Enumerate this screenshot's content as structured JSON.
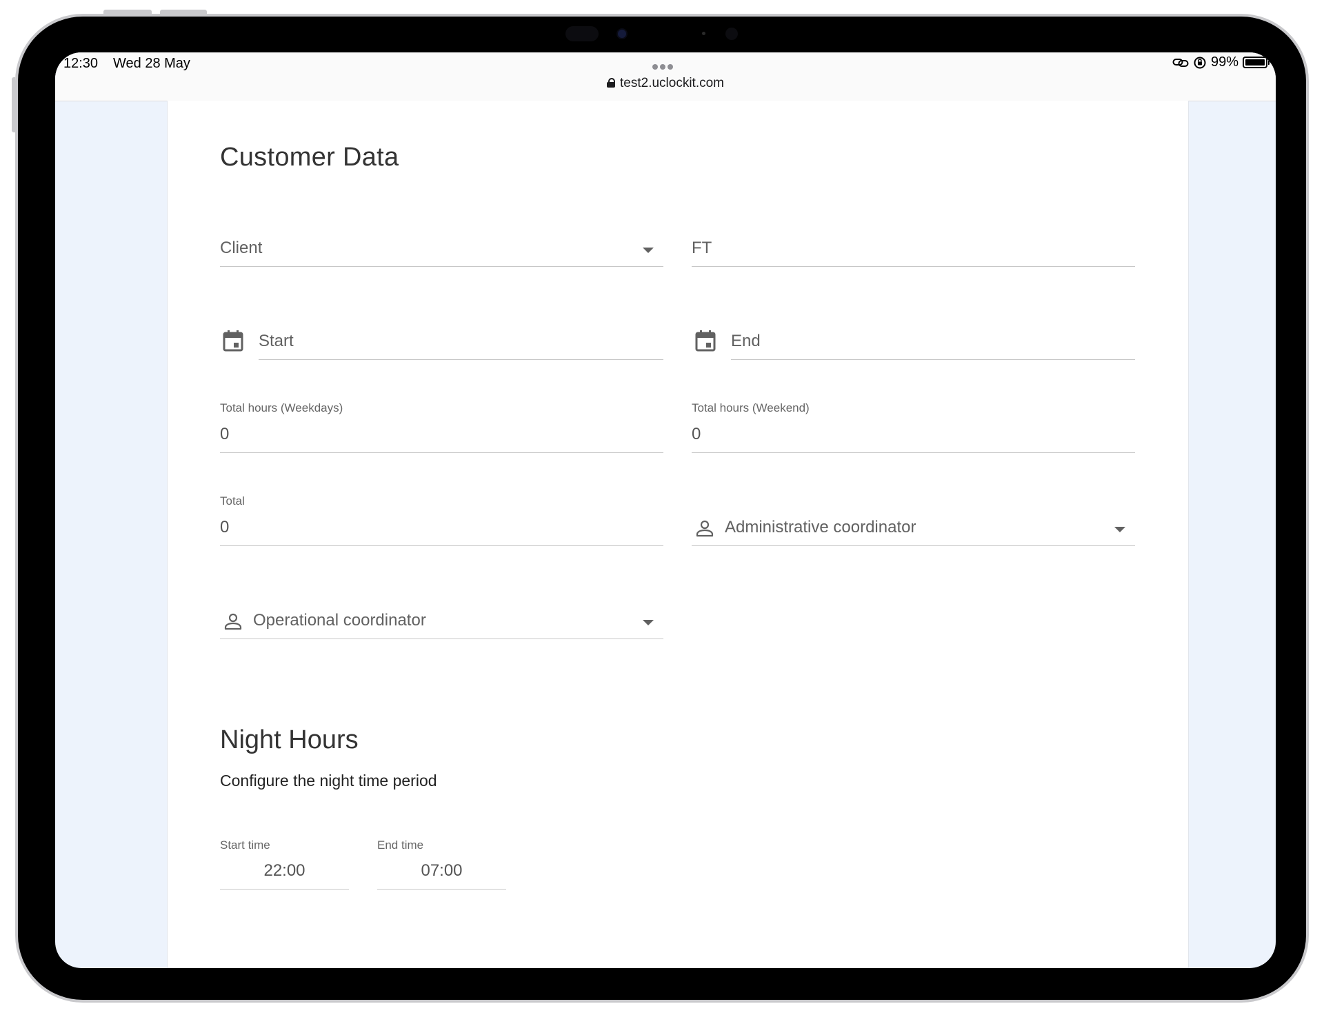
{
  "status_bar": {
    "time": "12:30",
    "date": "Wed 28 May",
    "url": "test2.uclockit.com",
    "battery": "99%",
    "battery_level": 0.99
  },
  "customer_data": {
    "title": "Customer Data",
    "client": {
      "placeholder": "Client"
    },
    "ft": {
      "placeholder": "FT"
    },
    "start": {
      "placeholder": "Start"
    },
    "end": {
      "placeholder": "End"
    },
    "total_hours_weekdays": {
      "label": "Total hours (Weekdays)",
      "value": "0"
    },
    "total_hours_weekend": {
      "label": "Total hours (Weekend)",
      "value": "0"
    },
    "total": {
      "label": "Total",
      "value": "0"
    },
    "administrative_coordinator": {
      "placeholder": "Administrative coordinator"
    },
    "operational_coordinator": {
      "placeholder": "Operational coordinator"
    }
  },
  "night_hours": {
    "title": "Night Hours",
    "subtitle": "Configure the night time period",
    "start_time": {
      "label": "Start time",
      "value": "22:00"
    },
    "end_time": {
      "label": "End time",
      "value": "07:00"
    }
  },
  "colors": {
    "page_background": "#edf3fc",
    "card_background": "#ffffff",
    "field_underline": "#c7c7c7",
    "icon_gray": "#616161"
  },
  "icons": [
    "lock-icon",
    "link-icon",
    "orientation-lock-icon",
    "battery-icon",
    "calendar-icon",
    "person-icon",
    "dropdown-arrow-icon"
  ]
}
